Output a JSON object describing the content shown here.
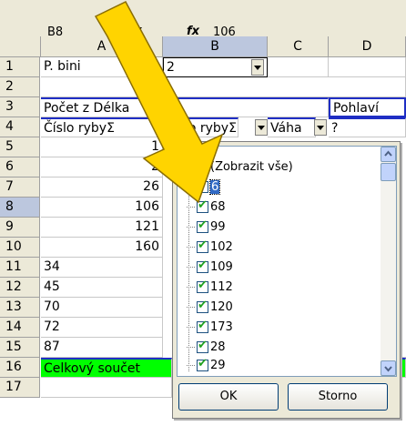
{
  "formula_bar": {
    "name_box": "B8",
    "fx_label": "fx",
    "value": "106"
  },
  "columns": [
    "A",
    "B",
    "C",
    "D"
  ],
  "rows": [
    "1",
    "2",
    "3",
    "4",
    "5",
    "6",
    "7",
    "8",
    "9",
    "10",
    "11",
    "12",
    "13",
    "14",
    "15",
    "16",
    "17"
  ],
  "cells": {
    "a1": "P. bini",
    "b1": "2",
    "a3": "Počet z Délka",
    "d3": "Pohlaví",
    "a4": "Číslo rybyΣ",
    "b4": "Číslo rybyΣ",
    "c4": "Váha",
    "d4": "?",
    "a5": "1",
    "a6": "2",
    "a7": "26",
    "a8": "106",
    "a9": "121",
    "a10": "160",
    "a11": "34",
    "a12": "45",
    "a13": "70",
    "a14": "72",
    "a15": "87",
    "a16": "Celkový součet"
  },
  "filter": {
    "show_all": "(Zobrazit vše)",
    "items": [
      "6",
      "68",
      "99",
      "102",
      "109",
      "112",
      "120",
      "173",
      "28",
      "29"
    ],
    "ok_label": "OK",
    "cancel_label": "Storno"
  },
  "colors": {
    "accent_blue": "#1f2ec4",
    "total_green": "#00ff00",
    "arrow_yellow": "#ffd400"
  }
}
